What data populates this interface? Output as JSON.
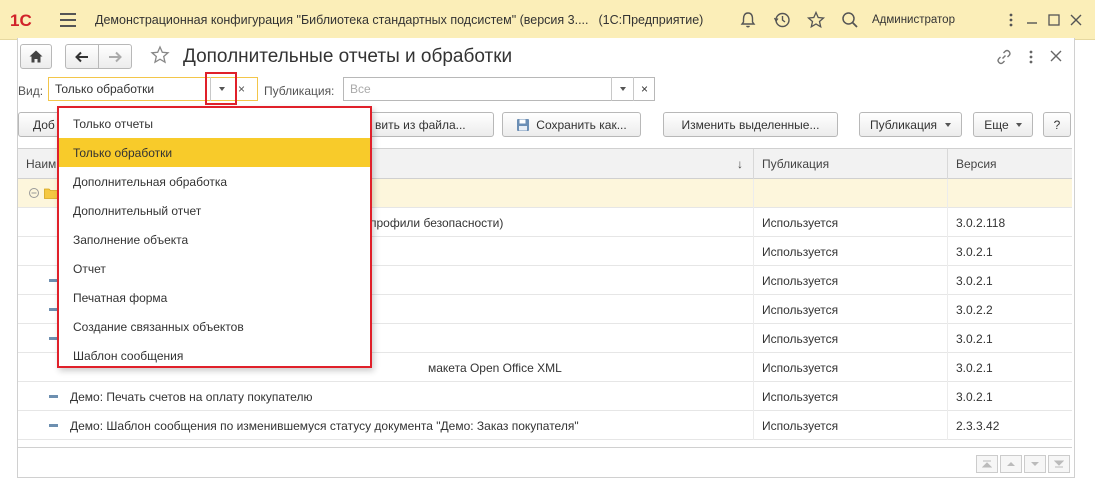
{
  "app": {
    "logo": "1С",
    "title": "Демонстрационная конфигурация \"Библиотека стандартных подсистем\" (версия 3....",
    "platform": "(1С:Предприятие)",
    "user": "Администратор"
  },
  "form": {
    "title": "Дополнительные отчеты и обработки",
    "filters": {
      "vid_label": "Вид:",
      "vid_value": "Только обработки",
      "clear": "×",
      "pub_label": "Публикация:",
      "pub_placeholder": "Все"
    },
    "toolbar": {
      "add_partial": "Доб",
      "load_partial": "вить из файла...",
      "save_as": "Сохранить как...",
      "change_selected": "Изменить выделенные...",
      "publication": "Публикация",
      "more": "Еще",
      "help": "?"
    },
    "columns": {
      "name_partial": "Наим",
      "sort_arrow": "↓",
      "publication": "Публикация",
      "version": "Версия"
    },
    "rows": [
      {
        "name": "",
        "publication": "",
        "version": ""
      },
      {
        "name": "профили безопасности)",
        "publication": "Используется",
        "version": "3.0.2.118"
      },
      {
        "name": "",
        "publication": "Используется",
        "version": "3.0.2.1"
      },
      {
        "name": "",
        "publication": "Используется",
        "version": "3.0.2.1"
      },
      {
        "name": "",
        "publication": "Используется",
        "version": "3.0.2.2"
      },
      {
        "name": "",
        "publication": "Используется",
        "version": "3.0.2.1"
      },
      {
        "name": "макета Open Office XML",
        "publication": "Используется",
        "version": "3.0.2.1"
      },
      {
        "name": "Демо: Печать счетов на оплату покупателю",
        "publication": "Используется",
        "version": "3.0.2.1"
      },
      {
        "name": "Демо: Шаблон сообщения по изменившемуся статусу документа \"Демо: Заказ покупателя\"",
        "publication": "Используется",
        "version": "2.3.3.42"
      }
    ],
    "dropdown": {
      "items": [
        "Только отчеты",
        "Только обработки",
        "Дополнительная обработка",
        "Дополнительный отчет",
        "Заполнение объекта",
        "Отчет",
        "Печатная форма",
        "Создание связанных объектов",
        "Шаблон сообщения"
      ],
      "selected": "Только обработки"
    }
  },
  "colors": {
    "titlebar": "#fbeeb8",
    "selected": "#f8cb2a",
    "highlight_border": "#e0202a",
    "group_row": "#fdf6dc"
  },
  "icons": [
    "menu-icon",
    "bell-icon",
    "history-icon",
    "star-icon",
    "search-icon",
    "home-icon",
    "back-icon",
    "forward-icon",
    "link-icon",
    "more-vert-icon",
    "close-icon",
    "save-icon",
    "collapse-icon",
    "folder-icon"
  ]
}
